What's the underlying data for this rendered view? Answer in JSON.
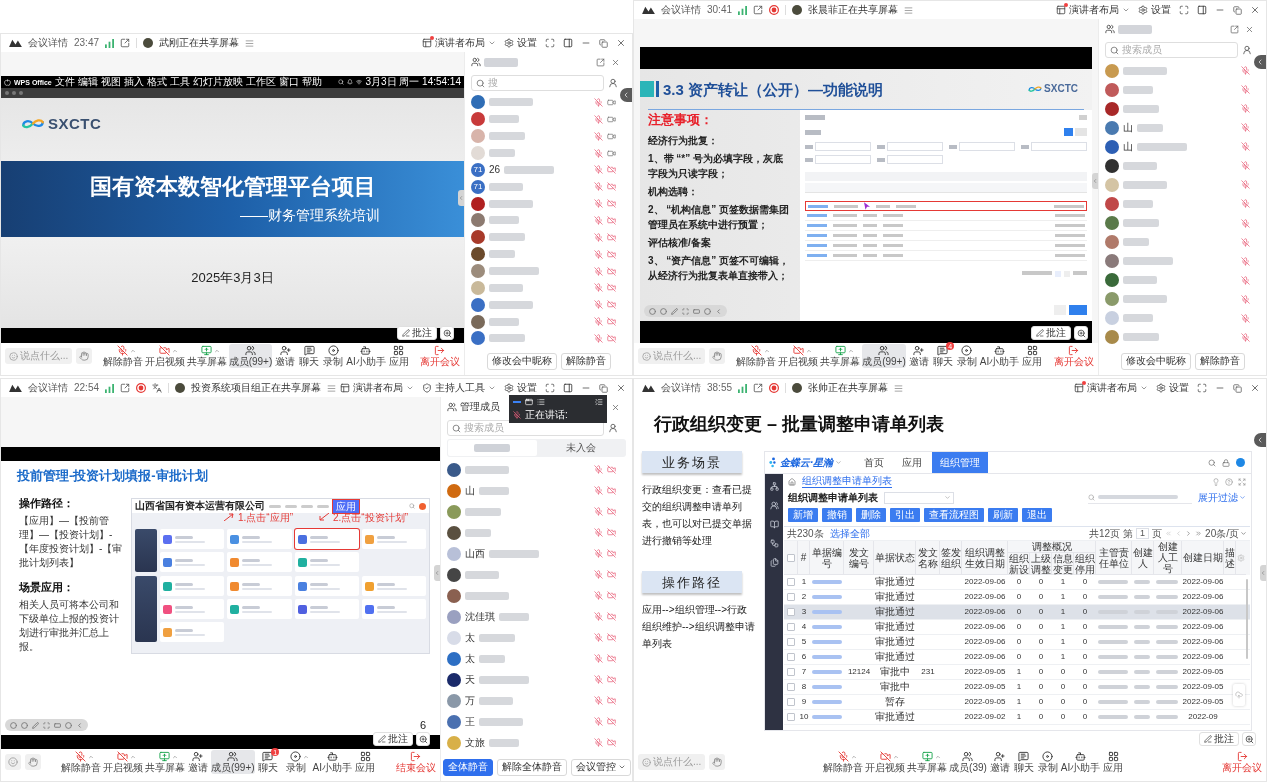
{
  "meetings": [
    {
      "title_bar": {
        "app": "会议详情",
        "time": "23:47",
        "recording": false,
        "captions": false,
        "sharing": "武刚正在共享屏幕",
        "tools": [
          {
            "kind": "layout",
            "label": "演讲者布局",
            "dot": true
          },
          {
            "kind": "settings",
            "label": "设置",
            "dot": false
          }
        ]
      },
      "side_tab": true,
      "slide": {
        "kind": "title",
        "menubar": {
          "items": [
            "WPS Office",
            "文件",
            "编辑",
            "视图",
            "插入",
            "格式",
            "工具",
            "幻灯片放映",
            "工作区",
            "窗口",
            "帮助"
          ],
          "clock": "3月3日 周一 14:54:14"
        },
        "logo": "SXCTC",
        "title": "国有资本数智化管理平台项目",
        "subtitle": "——财务管理系统培训",
        "date": "2025年3月3日"
      },
      "annotate": "批注",
      "panel": {
        "popout": true,
        "search": {
          "placeholder": "搜"
        },
        "members": [
          {
            "color": "#2f6db5",
            "muted": true,
            "camera": true
          },
          {
            "color": "#c83a3a",
            "muted": true,
            "camera": true
          },
          {
            "color": "#d8b4aa",
            "muted": true,
            "camera": true
          },
          {
            "color": "#e2dbd6",
            "muted": true,
            "camera": true
          },
          {
            "name": "26",
            "initials": "71",
            "color": "#3a6fc4",
            "muted": true,
            "camera": false
          },
          {
            "initials": "71",
            "color": "#3a6fc4",
            "muted": true,
            "camera": false
          },
          {
            "color": "#b02020",
            "muted": true,
            "camera": false
          },
          {
            "color": "#8c7a70",
            "muted": true,
            "camera": false
          },
          {
            "color": "#a83a2a",
            "muted": true,
            "camera": false
          },
          {
            "color": "#6b4a2b",
            "muted": true,
            "camera": false
          },
          {
            "color": "#9c8c7c",
            "muted": true,
            "camera": false
          },
          {
            "color": "#c9b99a",
            "muted": true,
            "camera": false
          },
          {
            "color": "#3a6fc4",
            "muted": true,
            "camera": false
          },
          {
            "color": "#7a6a5a",
            "muted": true,
            "camera": false
          },
          {
            "color": "#3a6fc4",
            "muted": true,
            "camera": false
          }
        ],
        "buttons": [
          {
            "label": "修改会中昵称",
            "kind": "default"
          },
          {
            "label": "解除静音",
            "kind": "default"
          }
        ]
      },
      "toolbar": {
        "say": {
          "placeholder": "说点什么..."
        },
        "items": [
          {
            "kind": "mic",
            "label": "解除静音",
            "menu": true,
            "selected": false
          },
          {
            "kind": "video",
            "label": "开启视频",
            "menu": true,
            "selected": false
          },
          {
            "kind": "share",
            "label": "共享屏幕",
            "menu": true,
            "selected": false
          },
          {
            "kind": "members",
            "label": "成员(99+)",
            "menu": false,
            "selected": true
          },
          {
            "kind": "invite",
            "label": "邀请",
            "menu": false,
            "selected": false
          },
          {
            "kind": "chat",
            "label": "聊天",
            "menu": false,
            "selected": false
          },
          {
            "kind": "record",
            "label": "录制",
            "menu": false,
            "selected": false
          },
          {
            "kind": "ai",
            "label": "AI小助手",
            "menu": false,
            "selected": false
          },
          {
            "kind": "apps",
            "label": "应用",
            "menu": false,
            "selected": false
          }
        ],
        "leave": "离开会议"
      }
    },
    {
      "title_bar": {
        "app": "会议详情",
        "time": "30:41",
        "recording": true,
        "captions": false,
        "sharing": "张晨菲正在共享屏幕",
        "tools": [
          {
            "kind": "layout",
            "label": "演讲者布局",
            "dot": true
          },
          {
            "kind": "settings",
            "label": "设置",
            "dot": false
          }
        ]
      },
      "side_tab": true,
      "slide": {
        "kind": "notes",
        "title": "3.3 资产转让（公开）—功能说明",
        "logo": "SXCTC",
        "heading": "注意事项：",
        "lines": [
          "经济行为批复：",
          "1、带 “*” 号为必填字段，灰底字段为只读字段；",
          "机构选聘：",
          "2、 “机构信息” 页签数据需集团管理员在系统中进行预置；",
          "评估核准/备案",
          "3、 “资产信息” 页签不可编辑，从经济行为批复表单直接带入；"
        ]
      },
      "annotate": "批注",
      "panel": {
        "popout": true,
        "search": {
          "placeholder": "搜索成员"
        },
        "members": [
          {
            "color": "#c89a50",
            "muted": true
          },
          {
            "color": "#c05a5a",
            "muted": true
          },
          {
            "color": "#a82828",
            "muted": true
          },
          {
            "name": "山",
            "color": "#4a7ab0",
            "muted": true
          },
          {
            "name": "山",
            "color": "#2d5fb4",
            "muted": true
          },
          {
            "color": "#303030",
            "muted": true
          },
          {
            "color": "#d4c4a4",
            "muted": true
          },
          {
            "color": "#c04848",
            "muted": true
          },
          {
            "color": "#5a7a4a",
            "muted": true
          },
          {
            "color": "#b07a6a",
            "muted": true
          },
          {
            "color": "#8a7a7a",
            "muted": true
          },
          {
            "color": "#3a6a3a",
            "muted": true
          },
          {
            "color": "#8a9a6a",
            "muted": true
          },
          {
            "color": "#c8d0e0",
            "muted": true
          },
          {
            "color": "#a88a4a",
            "muted": true
          }
        ],
        "buttons": [
          {
            "label": "修改会中昵称",
            "kind": "default"
          },
          {
            "label": "解除静音",
            "kind": "default"
          }
        ]
      },
      "toolbar": {
        "say": {
          "placeholder": "说点什么..."
        },
        "items": [
          {
            "kind": "mic",
            "label": "解除静音",
            "menu": true,
            "selected": false
          },
          {
            "kind": "video",
            "label": "开启视频",
            "menu": true,
            "selected": false
          },
          {
            "kind": "share",
            "label": "共享屏幕",
            "menu": true,
            "selected": false
          },
          {
            "kind": "members",
            "label": "成员(99+)",
            "menu": false,
            "selected": true
          },
          {
            "kind": "invite",
            "label": "邀请",
            "menu": false,
            "selected": false
          },
          {
            "kind": "chat",
            "label": "聊天",
            "menu": false,
            "selected": false,
            "badge": "4"
          },
          {
            "kind": "record",
            "label": "录制",
            "menu": false,
            "selected": false
          },
          {
            "kind": "ai",
            "label": "AI小助手",
            "menu": false,
            "selected": false
          },
          {
            "kind": "apps",
            "label": "应用",
            "menu": false,
            "selected": false
          }
        ],
        "leave": "离开会议"
      }
    },
    {
      "title_bar": {
        "app": "会议详情",
        "time": "22:54",
        "recording": true,
        "captions": true,
        "sharing": "投资系统项目组正在共享屏幕",
        "tools": [
          {
            "kind": "layout",
            "label": "演讲者布局",
            "dot": false
          },
          {
            "kind": "host",
            "label": "主持人工具",
            "dot": false
          },
          {
            "kind": "settings",
            "label": "设置",
            "dot": false
          }
        ]
      },
      "side_tab": false,
      "speaking": {
        "label": "正在讲话:"
      },
      "slide": {
        "kind": "path",
        "title": "投前管理-投资计划填报-审批计划",
        "sections": [
          {
            "heading": "操作路径：",
            "text": "【应用】—【投前管理】—【投资计划】-【年度投资计划】-【审批计划列表】"
          },
          {
            "heading": "场景应用：",
            "text": "相关人员可将本公司和下级单位上报的投资计划进行审批并汇总上报。"
          }
        ],
        "page": "6",
        "screenshot": {
          "company": "山西省国有资本运营有限公司",
          "tab": {
            "label": "应用",
            "selected": true
          },
          "callouts": [
            "1.点击“应用”",
            "2.点击“投资计划”"
          ],
          "tile_groups": [
            [
              {
                "color": "#5b6ff0",
                "highlighted": false
              },
              {
                "color": "#4a90e2",
                "highlighted": false
              },
              {
                "color": "#4a6fe0",
                "highlighted": true
              },
              {
                "color": "#f0a040",
                "highlighted": false
              },
              {
                "color": "#4a80e0",
                "highlighted": false
              },
              {
                "color": "#f08a30",
                "highlighted": false
              },
              {
                "color": "#20b0a0",
                "highlighted": false
              }
            ],
            [
              {
                "color": "#20b0a0",
                "highlighted": false
              },
              {
                "color": "#f08a30",
                "highlighted": false
              },
              {
                "color": "#4a80e0",
                "highlighted": false
              },
              {
                "color": "#f0a030",
                "highlighted": false
              },
              {
                "color": "#f05080",
                "highlighted": false
              },
              {
                "color": "#20b0a0",
                "highlighted": false
              },
              {
                "color": "#5060e0",
                "highlighted": false
              },
              {
                "color": "#5070f0",
                "highlighted": false
              },
              {
                "color": "#f0a040",
                "highlighted": false
              }
            ]
          ]
        }
      },
      "annotate": "批注",
      "panel": {
        "title": "管理成员",
        "popout": false,
        "search": {
          "placeholder": "搜索成员"
        },
        "tabs": [
          {
            "selected": true
          },
          {
            "label": "未入会",
            "selected": false
          }
        ],
        "members": [
          {
            "color": "#3a5a8a",
            "muted": true,
            "camera": false
          },
          {
            "name": "山",
            "color": "#d06a10",
            "muted": true,
            "camera": false
          },
          {
            "color": "#8a9a5a",
            "muted": true,
            "camera": false
          },
          {
            "color": "#5a5040",
            "muted": true,
            "camera": false
          },
          {
            "name": "山西",
            "color": "#b8c0d8",
            "muted": true,
            "camera": false
          },
          {
            "color": "#454545",
            "muted": true,
            "camera": false
          },
          {
            "color": "#8a6050",
            "muted": true,
            "camera": false
          },
          {
            "name": "沈佳琪",
            "color": "#9aa0c0",
            "muted": true,
            "camera": false
          },
          {
            "name": "太",
            "color": "#d8dce8",
            "muted": true,
            "camera": false
          },
          {
            "name": "太",
            "color": "#2d6fc4",
            "muted": true,
            "camera": false
          },
          {
            "name": "天",
            "color": "#1a2a6a",
            "muted": true,
            "camera": false
          },
          {
            "name": "万",
            "color": "#8a98a8",
            "muted": true,
            "camera": false
          },
          {
            "name": "王",
            "color": "#4a70b0",
            "muted": true,
            "camera": false
          },
          {
            "name": "文旅",
            "color": "#d8b048",
            "muted": true,
            "camera": false
          }
        ],
        "buttons": [
          {
            "label": "全体静音",
            "kind": "primary"
          },
          {
            "label": "解除全体静音",
            "kind": "default"
          },
          {
            "label": "会议管控",
            "kind": "dropdown"
          }
        ]
      },
      "toolbar": {
        "items": [
          {
            "kind": "mic",
            "label": "解除静音",
            "menu": true,
            "selected": false
          },
          {
            "kind": "video",
            "label": "开启视频",
            "menu": true,
            "selected": false
          },
          {
            "kind": "share",
            "label": "共享屏幕",
            "menu": true,
            "selected": false
          },
          {
            "kind": "invite",
            "label": "邀请",
            "menu": false,
            "selected": false
          },
          {
            "kind": "members",
            "label": "成员(99+)",
            "menu": false,
            "selected": true
          },
          {
            "kind": "chat",
            "label": "聊天",
            "menu": false,
            "selected": false,
            "badge": "1"
          },
          {
            "kind": "record",
            "label": "录制",
            "menu": true,
            "selected": false
          },
          {
            "kind": "ai",
            "label": "AI小助手",
            "menu": false,
            "selected": false
          },
          {
            "kind": "apps",
            "label": "应用",
            "menu": false,
            "selected": false
          }
        ],
        "leave": "结束会议"
      }
    },
    {
      "title_bar": {
        "app": "会议详情",
        "time": "38:55",
        "recording": true,
        "captions": false,
        "sharing": "张帅正在共享屏幕",
        "tools": [
          {
            "kind": "layout",
            "label": "演讲者布局",
            "dot": true
          },
          {
            "kind": "settings",
            "label": "设置",
            "dot": false
          }
        ]
      },
      "side_tab": true,
      "slide": {
        "kind": "table",
        "title": "行政组织变更 – 批量调整申请单列表",
        "sections": [
          {
            "heading": "业务场景",
            "text": "行政组织变更：查看已提交的组织调整申请单列表，也可以对已提交单据进行撤销等处理"
          },
          {
            "heading": "操作路径",
            "text": "应用-->组织管理-->行政组织维护-->组织调整申请单列表"
          }
        ],
        "app": {
          "brand": "金蝶云·星瀚",
          "nav": [
            {
              "label": "首页",
              "selected": false
            },
            {
              "label": "应用",
              "selected": false
            },
            {
              "label": "组织管理",
              "selected": true
            }
          ],
          "breadcrumb": "组织调整申请单列表",
          "list_title": "组织调整申请单列表",
          "filter": "展开过滤",
          "buttons": [
            "新增",
            "撤销",
            "删除",
            "引出",
            "查看流程图",
            "刷新",
            "退出"
          ],
          "total": "共230条",
          "select_all": "选择全部",
          "pages": "共12页",
          "page_prefix": "第",
          "page": "1",
          "page_suffix": "页",
          "page_size": "20条/页",
          "all_checked": false,
          "columns": [
            {
              "label": "#"
            },
            {
              "label": "单据编号"
            },
            {
              "label": "发文编号"
            },
            {
              "label": "单据状态"
            },
            {
              "label": "发文名称"
            },
            {
              "label": "签发组织"
            },
            {
              "label": "组织调整生效日期"
            },
            {
              "label": "调整概况",
              "children": [
                {
                  "label": "组织新设"
                },
                {
                  "label": "上级调整"
                },
                {
                  "label": "信息变更"
                },
                {
                  "label": "组织停用"
                }
              ]
            },
            {
              "label": "主管责任单位"
            },
            {
              "label": "创建人"
            },
            {
              "label": "创建人工号"
            },
            {
              "label": "创建日期"
            },
            {
              "label": "描述"
            }
          ],
          "rows": [
            {
              "no": "1",
              "status": "审批通过",
              "date": "2022-09-06",
              "counts": [
                "0",
                "0",
                "1",
                "0"
              ],
              "created": "2022-09-06",
              "checked": false,
              "selected": false
            },
            {
              "no": "2",
              "status": "审批通过",
              "date": "2022-09-06",
              "counts": [
                "0",
                "0",
                "1",
                "0"
              ],
              "created": "2022-09-06",
              "checked": false,
              "selected": false
            },
            {
              "no": "3",
              "status": "审批通过",
              "date": "2022-09-06",
              "counts": [
                "0",
                "0",
                "1",
                "0"
              ],
              "created": "2022-09-06",
              "checked": false,
              "selected": true
            },
            {
              "no": "4",
              "status": "审批通过",
              "date": "2022-09-06",
              "counts": [
                "0",
                "0",
                "1",
                "0"
              ],
              "created": "2022-09-06",
              "checked": false,
              "selected": false
            },
            {
              "no": "5",
              "status": "审批通过",
              "date": "2022-09-06",
              "counts": [
                "0",
                "0",
                "1",
                "0"
              ],
              "created": "2022-09-06",
              "checked": false,
              "selected": false
            },
            {
              "no": "6",
              "status": "审批通过",
              "date": "2022-09-06",
              "counts": [
                "0",
                "0",
                "1",
                "0"
              ],
              "created": "2022-09-06",
              "checked": false,
              "selected": false
            },
            {
              "no": "7",
              "doc_no": "12124",
              "status": "审批中",
              "doc_name": "231",
              "date": "2022-09-05",
              "counts": [
                "1",
                "0",
                "0",
                "0"
              ],
              "created": "2022-09-05",
              "checked": false,
              "selected": false
            },
            {
              "no": "8",
              "status": "审批中",
              "date": "2022-09-05",
              "counts": [
                "1",
                "0",
                "0",
                "0"
              ],
              "created": "2022-09-05",
              "checked": false,
              "selected": false
            },
            {
              "no": "9",
              "status": "暂存",
              "date": "2022-09-05",
              "counts": [
                "1",
                "0",
                "0",
                "0"
              ],
              "created": "2022-09-05",
              "checked": false,
              "selected": false
            },
            {
              "no": "10",
              "status": "审批通过",
              "date": "2022-09-02",
              "counts": [
                "1",
                "0",
                "0",
                "0"
              ],
              "created": "2022-09",
              "checked": false,
              "selected": false
            }
          ]
        }
      },
      "annotate": "批注",
      "toolbar": {
        "say": {
          "placeholder": "说点什么..."
        },
        "items": [
          {
            "kind": "mic",
            "label": "解除静音",
            "menu": true,
            "selected": false
          },
          {
            "kind": "video",
            "label": "开启视频",
            "menu": true,
            "selected": false
          },
          {
            "kind": "share",
            "label": "共享屏幕",
            "menu": true,
            "selected": false
          },
          {
            "kind": "members",
            "label": "成员(39)",
            "menu": false,
            "selected": false
          },
          {
            "kind": "invite",
            "label": "邀请",
            "menu": false,
            "selected": false
          },
          {
            "kind": "chat",
            "label": "聊天",
            "menu": false,
            "selected": false
          },
          {
            "kind": "record",
            "label": "录制",
            "menu": false,
            "selected": false
          },
          {
            "kind": "ai",
            "label": "AI小助手",
            "menu": false,
            "selected": false
          },
          {
            "kind": "apps",
            "label": "应用",
            "menu": false,
            "selected": false
          }
        ],
        "leave": "离开会议"
      }
    }
  ]
}
